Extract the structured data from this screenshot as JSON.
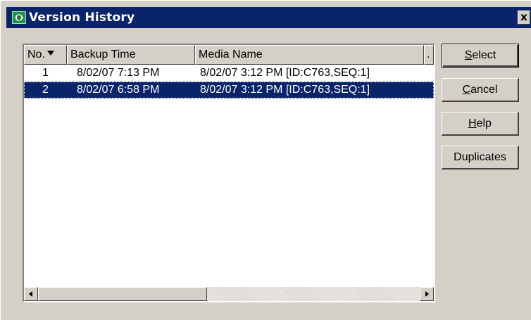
{
  "window": {
    "title": "Version History",
    "close_label": "x"
  },
  "list": {
    "columns": [
      {
        "label": "No."
      },
      {
        "label": "Backup Time"
      },
      {
        "label": "Media Name"
      },
      {
        "label": "."
      }
    ],
    "sort_column": "No.",
    "rows": [
      {
        "no": "1",
        "backup_time": "8/02/07  7:13 PM",
        "media_name": "8/02/07 3:12 PM [ID:C763,SEQ:1]",
        "selected": false
      },
      {
        "no": "2",
        "backup_time": "8/02/07  6:58 PM",
        "media_name": "8/02/07 3:12 PM [ID:C763,SEQ:1]",
        "selected": true
      }
    ]
  },
  "buttons": {
    "select": {
      "label_underlined": "S",
      "label_rest": "elect"
    },
    "cancel": {
      "label_underlined": "C",
      "label_rest": "ancel"
    },
    "help": {
      "label_underlined": "H",
      "label_rest": "elp"
    },
    "duplicates": {
      "label": "Duplicates"
    }
  },
  "colors": {
    "titlebar": "#0a246a",
    "selection": "#0a246a",
    "face": "#d4d0c8"
  },
  "icons": {
    "app": "version-history-app-icon",
    "close": "close-icon",
    "sort": "sort-descending-icon",
    "scroll_left": "arrow-left-icon",
    "scroll_right": "arrow-right-icon"
  }
}
